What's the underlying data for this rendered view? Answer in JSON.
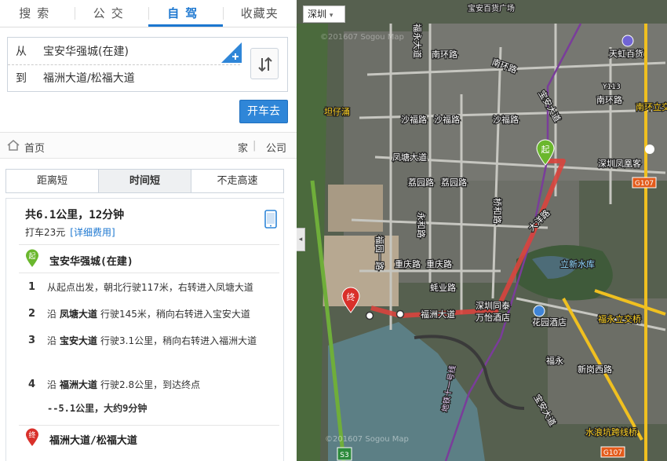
{
  "tabs": [
    {
      "label": "搜索"
    },
    {
      "label": "公交"
    },
    {
      "label": "自驾"
    },
    {
      "label": "收藏夹"
    }
  ],
  "route_input": {
    "from_label": "从",
    "from_value": "宝安华强城(在建)",
    "to_label": "到",
    "to_value": "福洲大道/松福大道",
    "go_button": "开车去"
  },
  "crumb": {
    "home": "首页",
    "home_addr": "家",
    "company": "公司",
    "sep": "|"
  },
  "modes": [
    {
      "label": "距离短"
    },
    {
      "label": "时间短"
    },
    {
      "label": "不走高速"
    }
  ],
  "route": {
    "summary": "共6.1公里，12分钟",
    "taxi": "打车23元",
    "taxi_link": "[详细费用]",
    "start_marker": "起",
    "end_marker": "终",
    "start": "宝安华强城(在建)",
    "end": "福洲大道/松福大道",
    "steps": [
      {
        "num": "1",
        "pre": "从起点出发，朝北行驶117米，右转进入凤塘大道",
        "road": "",
        "post": ""
      },
      {
        "num": "2",
        "pre": "沿",
        "road": "凤塘大道",
        "post": "行驶145米，稍向右转进入宝安大道"
      },
      {
        "num": "3",
        "pre": "沿",
        "road": "宝安大道",
        "post": "行驶3.1公里，稍向右转进入福洲大道"
      },
      {
        "num": "4",
        "pre": "沿",
        "road": "福洲大道",
        "post": "行驶2.8公里，到达终点"
      }
    ],
    "subtotal": "--5.1公里，大约9分钟"
  },
  "map": {
    "city": "深圳",
    "city_arrow": "▾",
    "collapse_arrow": "◂",
    "labels": [
      {
        "text": "南环路"
      },
      {
        "text": "南环路"
      },
      {
        "text": "天虹百货"
      },
      {
        "text": "Y113"
      },
      {
        "text": "南环路"
      },
      {
        "text": "南环立交"
      },
      {
        "text": "坦仔涌"
      },
      {
        "text": "沙福路"
      },
      {
        "text": "沙福路"
      },
      {
        "text": "沙福路"
      },
      {
        "text": "凤塘大道"
      },
      {
        "text": "宝安大道"
      },
      {
        "text": "深圳凤凰客"
      },
      {
        "text": "G107"
      },
      {
        "text": "荔园路"
      },
      {
        "text": "荔园路"
      },
      {
        "text": "永和路"
      },
      {
        "text": "桥和路"
      },
      {
        "text": "大洋路"
      },
      {
        "text": "福园一路"
      },
      {
        "text": "立新水库"
      },
      {
        "text": "重庆路"
      },
      {
        "text": "重庆路"
      },
      {
        "text": "蚝业路"
      },
      {
        "text": "深圳同泰"
      },
      {
        "text": "万怡酒店"
      },
      {
        "text": "福洲大道"
      },
      {
        "text": "花园酒店"
      },
      {
        "text": "福永立交桥"
      },
      {
        "text": "福永"
      },
      {
        "text": "新岗西路"
      },
      {
        "text": "宝安大道"
      },
      {
        "text": "水浪坑跨线桥"
      },
      {
        "text": "G107"
      },
      {
        "text": "S3"
      },
      {
        "text": "地铁十一号线"
      },
      {
        "text": "福永大道"
      },
      {
        "text": "宝安百货广场"
      }
    ],
    "watermark_1": "©201607 Sogou Map",
    "watermark_2": "©201607 Sogou Map",
    "start_pin": "起",
    "end_pin": "终",
    "colors": {
      "route": "#d9443d",
      "metro": "#7a3d9a",
      "road_yellow": "#f0c020",
      "label_yellow": "#ffd21f"
    }
  }
}
